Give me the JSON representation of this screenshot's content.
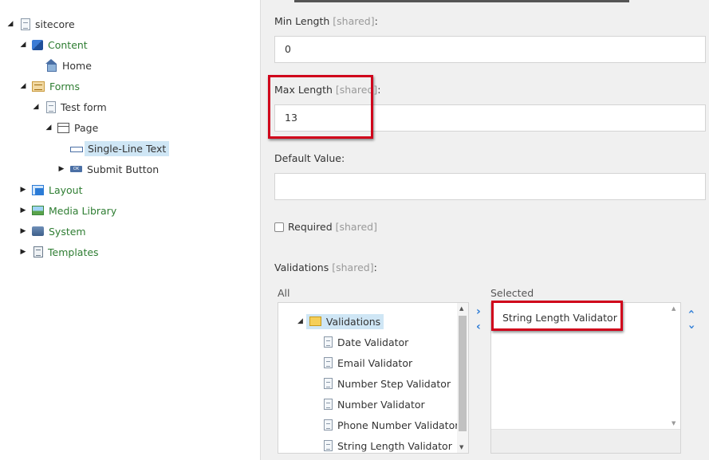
{
  "tree": {
    "items": [
      {
        "label": "sitecore",
        "arrow": "◢",
        "icon": "document-icon"
      },
      {
        "label": "Content",
        "arrow": "◢",
        "icon": "cubes-icon"
      },
      {
        "label": "Home",
        "arrow": "",
        "icon": "home-icon"
      },
      {
        "label": "Forms",
        "arrow": "◢",
        "icon": "form-icon"
      },
      {
        "label": "Test form",
        "arrow": "◢",
        "icon": "document-icon"
      },
      {
        "label": "Page",
        "arrow": "◢",
        "icon": "page-icon"
      },
      {
        "label": "Single-Line Text",
        "arrow": "",
        "icon": "input-field-icon"
      },
      {
        "label": "Submit Button",
        "arrow": "▶",
        "icon": "button-icon"
      },
      {
        "label": "Layout",
        "arrow": "▶",
        "icon": "layout-icon"
      },
      {
        "label": "Media Library",
        "arrow": "▶",
        "icon": "media-icon"
      },
      {
        "label": "System",
        "arrow": "▶",
        "icon": "system-icon"
      },
      {
        "label": "Templates",
        "arrow": "▶",
        "icon": "templates-icon"
      }
    ],
    "selected": "Single-Line Text"
  },
  "fields": {
    "shared_tag": "[shared]",
    "min_length": {
      "label": "Min Length",
      "value": "0"
    },
    "max_length": {
      "label": "Max Length",
      "value": "13"
    },
    "default_value": {
      "label": "Default Value:",
      "value": ""
    },
    "required": {
      "label": "Required",
      "checked": false
    },
    "validations": {
      "label": "Validations"
    }
  },
  "validations": {
    "all_label": "All",
    "selected_label": "Selected",
    "folder": "Validations",
    "all_items": [
      "Date Validator",
      "Email Validator",
      "Number Step Validator",
      "Number Validator",
      "Phone Number Validator",
      "String Length Validator"
    ],
    "selected_items": [
      "String Length Validator"
    ]
  },
  "colors": {
    "highlight": "#d0021b",
    "tree_green": "#2e7d32",
    "selection": "#cfe6f5",
    "arrow_blue": "#2b7bd6"
  }
}
